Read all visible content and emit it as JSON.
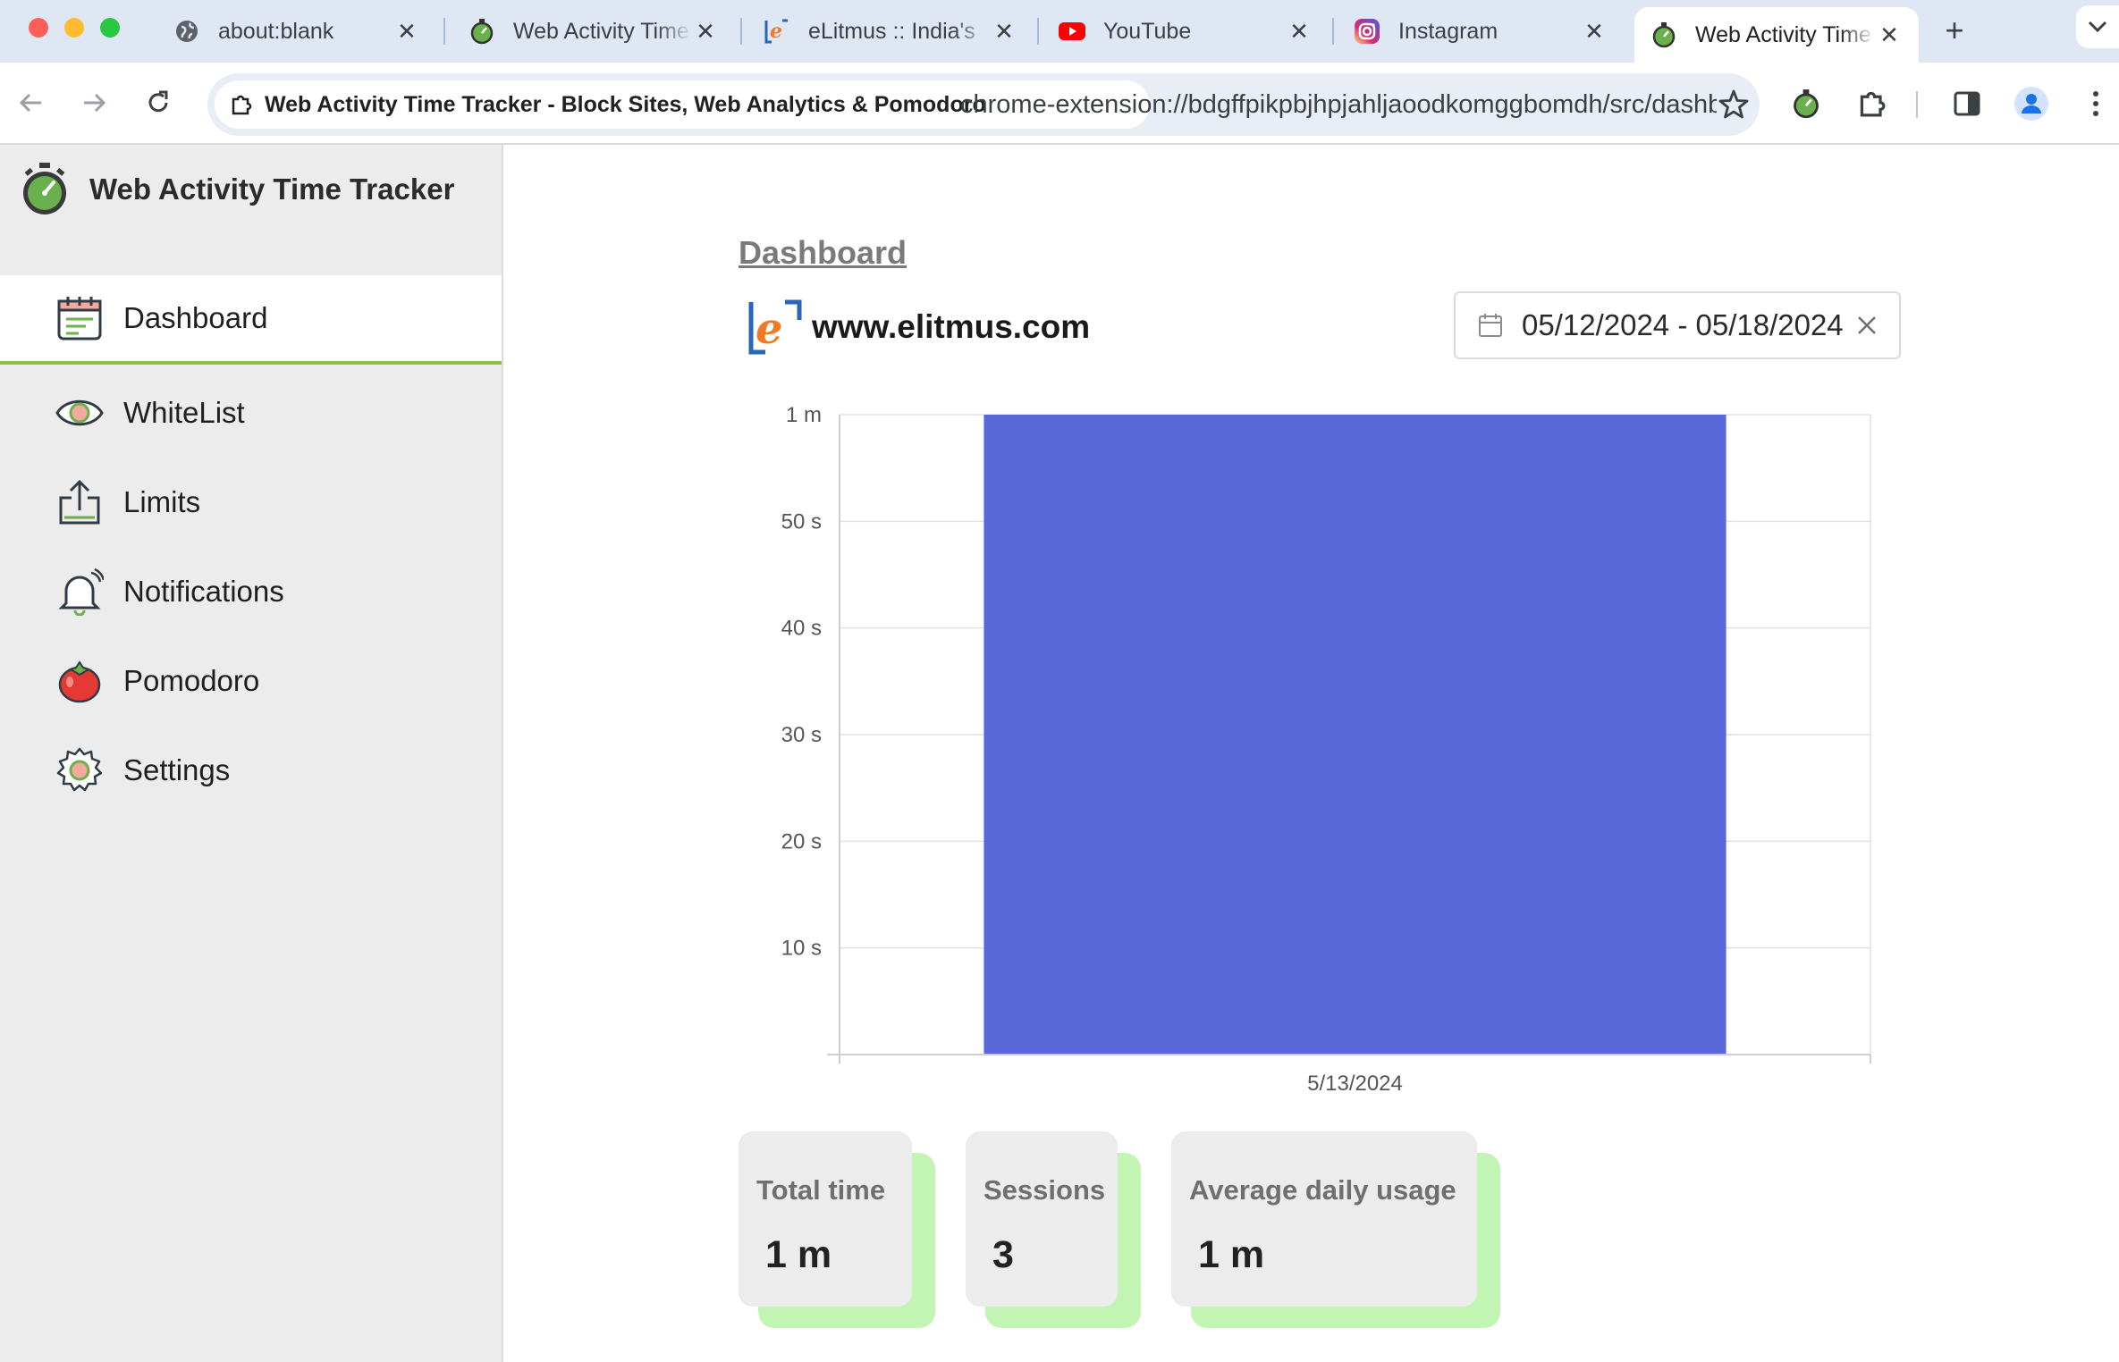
{
  "browser": {
    "tabs": [
      {
        "title": "about:blank",
        "favicon": "globe-icon",
        "active": false
      },
      {
        "title": "Web Activity Time Tracker",
        "favicon": "stopwatch-icon",
        "active": false
      },
      {
        "title": "eLitmus :: India's",
        "favicon": "elitmus-icon",
        "active": false
      },
      {
        "title": "YouTube",
        "favicon": "youtube-icon",
        "active": false
      },
      {
        "title": "Instagram",
        "favicon": "instagram-icon",
        "active": false
      },
      {
        "title": "Web Activity Time Tracker",
        "favicon": "stopwatch-icon",
        "active": true
      }
    ],
    "page_chip": "Web Activity Time Tracker - Block Sites, Web Analytics & Pomodoro",
    "url": "chrome-extension://bdgffpikpbjhpjahljaoodkomggbomdh/src/dashboard.html"
  },
  "sidebar": {
    "app_name": "Web Activity Time Tracker",
    "items": [
      {
        "label": "Dashboard",
        "icon": "calendar-icon",
        "active": true
      },
      {
        "label": "WhiteList",
        "icon": "eye-icon",
        "active": false
      },
      {
        "label": "Limits",
        "icon": "upload-icon",
        "active": false
      },
      {
        "label": "Notifications",
        "icon": "bell-icon",
        "active": false
      },
      {
        "label": "Pomodoro",
        "icon": "tomato-icon",
        "active": false
      },
      {
        "label": "Settings",
        "icon": "gear-icon",
        "active": false
      }
    ]
  },
  "main": {
    "title": "Dashboard",
    "site": "www.elitmus.com",
    "date_range": "05/12/2024 - 05/18/2024"
  },
  "chart_data": {
    "type": "bar",
    "categories": [
      "5/13/2024"
    ],
    "series": [
      {
        "values": [
          60
        ]
      }
    ],
    "y_unit": "seconds",
    "ylim": [
      0,
      60
    ],
    "yticks": [
      {
        "value": 10,
        "label": "10 s"
      },
      {
        "value": 20,
        "label": "20 s"
      },
      {
        "value": 30,
        "label": "30 s"
      },
      {
        "value": 40,
        "label": "40 s"
      },
      {
        "value": 50,
        "label": "50 s"
      },
      {
        "value": 60,
        "label": "1 m"
      }
    ],
    "grid": true,
    "bar_color": "#5a67d8"
  },
  "stats": [
    {
      "label": "Total time",
      "value": "1 m"
    },
    {
      "label": "Sessions",
      "value": "3"
    },
    {
      "label": "Average daily usage",
      "value": "1 m"
    }
  ],
  "colors": {
    "accent_green": "#8ac24a",
    "card_shadow": "#c2f5b4",
    "tabstrip": "#dfe7f5"
  }
}
